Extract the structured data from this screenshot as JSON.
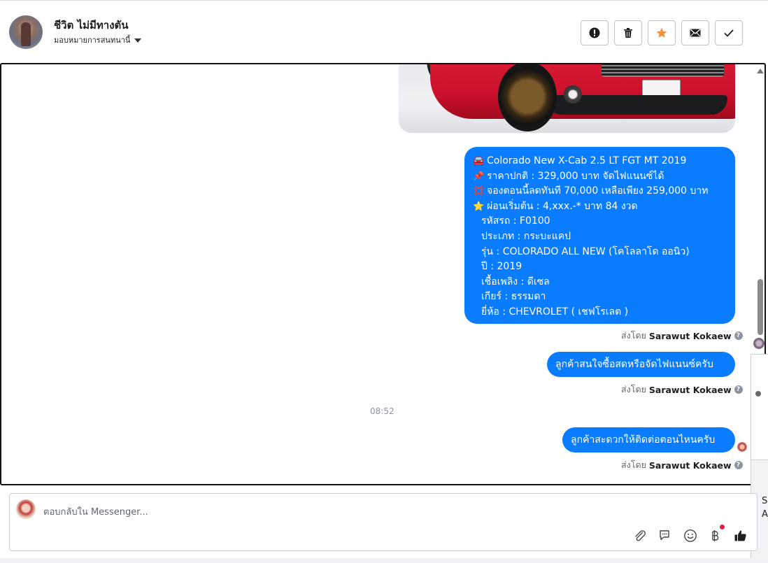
{
  "header": {
    "title": "ชีวิต ไม่มีทางตัน",
    "assign_label": "มอบหมายการสนทนานี้",
    "buttons": [
      {
        "name": "report-button",
        "icon": "alert-circle-icon"
      },
      {
        "name": "delete-button",
        "icon": "trash-icon"
      },
      {
        "name": "star-button",
        "icon": "star-icon"
      },
      {
        "name": "mark-unread-button",
        "icon": "envelope-icon"
      },
      {
        "name": "mark-done-button",
        "icon": "checkmark-icon"
      }
    ]
  },
  "messages": {
    "info": {
      "line1": "Colorado New X-Cab 2.5 LT FGT MT 2019",
      "line2": "ราคาปกติ : 329,000 บาท จัดไฟแนนซ์ได้",
      "line3": "จองตอนนี้ลดทันที 70,000 เหลือเพียง 259,000 บาท",
      "line4": "ผ่อนเริ่มต้น : 4,xxx.-* บาท 84 งวด",
      "line5": "รหัสรถ : F0100",
      "line6": "ประเภท : กระบะแคป",
      "line7": "รุ่น : COLORADO ALL NEW (โคโลลาโด ออนิว)",
      "line8": "ปี : 2019",
      "line9": "เชื้อเพลิง : ดีเซล",
      "line10": "เกียร์ : ธรรมดา",
      "line11": "ยี่ห้อ : CHEVROLET ( เชฟโรเลต )"
    },
    "msg2": "ลูกค้าสนใจซื้อสดหรือจัดไฟแนนซ์ครับ",
    "msg3": "ลูกค้าสะดวกให้ติดต่อตอนไหนครับ",
    "sent_by_prefix": "ส่งโดย",
    "sender": "Sarawut Kokaew",
    "time": "08:52"
  },
  "composer": {
    "placeholder": "ตอบกลับใน Messenger..."
  },
  "side": {
    "text1": "S",
    "text2": "A"
  },
  "colors": {
    "bubble": "#0a7cff",
    "star": "#f7923b"
  }
}
